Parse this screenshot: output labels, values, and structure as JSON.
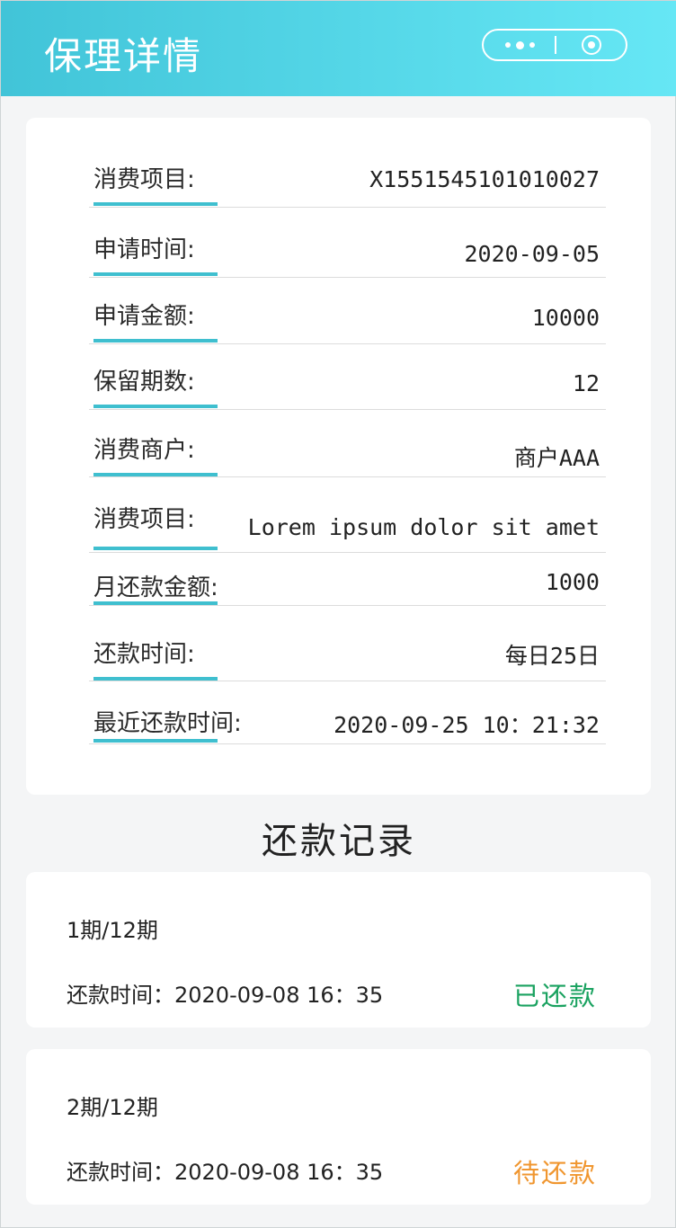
{
  "header": {
    "title": "保理详情"
  },
  "details": [
    {
      "label": "消费项目:",
      "value": "X1551545101010027"
    },
    {
      "label": "申请时间:",
      "value": "2020-09-05"
    },
    {
      "label": "申请金额:",
      "value": "10000"
    },
    {
      "label": "保留期数:",
      "value": "12"
    },
    {
      "label": "消费商户:",
      "value": "商户AAA"
    },
    {
      "label": "消费项目:",
      "value": "Lorem ipsum dolor sit amet"
    },
    {
      "label": "月还款金额:",
      "value": "1000"
    },
    {
      "label": "还款时间:",
      "value": "每日25日"
    },
    {
      "label": "最近还款时间:",
      "value": "2020-09-25 10：21:32"
    }
  ],
  "records_title": "还款记录",
  "records": [
    {
      "period": "1期/12期",
      "time": "还款时间：2020-09-08 16：35",
      "status": "已还款",
      "status_color": "#1aa260"
    },
    {
      "period": "2期/12期",
      "time": "还款时间：2020-09-08 16：35",
      "status": "待还款",
      "status_color": "#f0962f"
    }
  ],
  "icons": {
    "more": "more-dots-icon",
    "close": "close-circle-icon"
  }
}
